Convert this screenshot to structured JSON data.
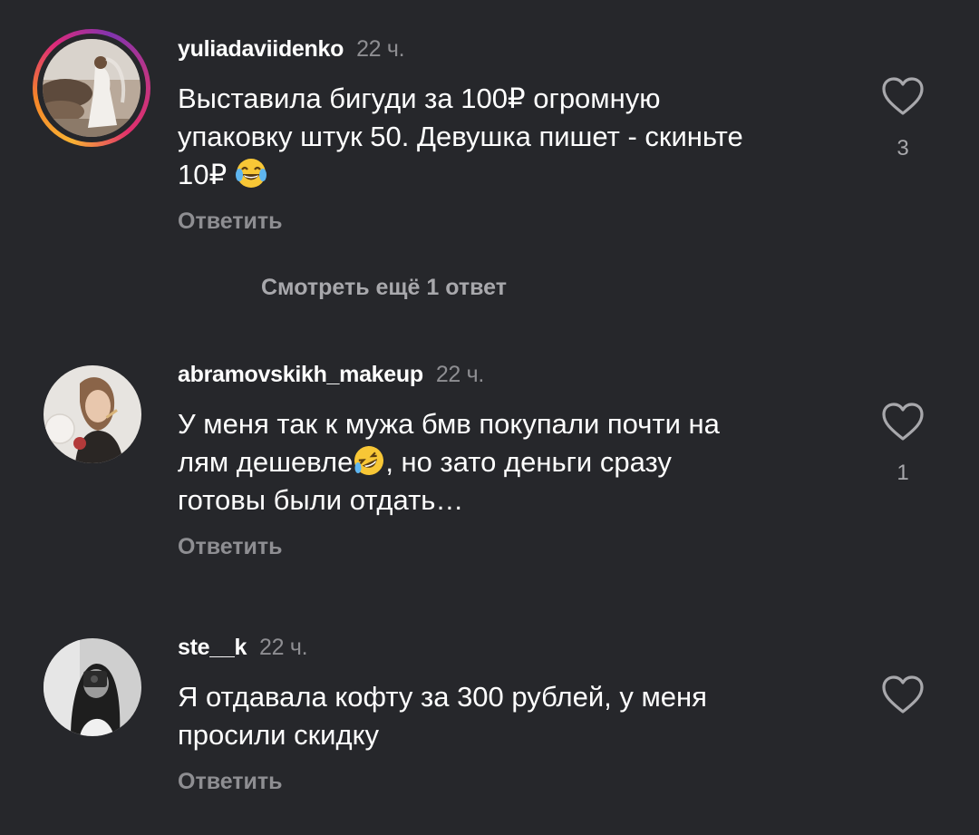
{
  "comments": [
    {
      "username": "yuliadaviidenko",
      "time": "22 ч.",
      "text_line1": "Выставила бигуди за 100₽ огромную",
      "text_line2": "упаковку штук 50. Девушка пишет - скиньте",
      "text_line3": "10₽",
      "emoji": "face-with-tears-of-joy",
      "reply_label": "Ответить",
      "likes": "3",
      "has_story_ring": true
    },
    {
      "username": "abramovskikh_makeup",
      "time": "22 ч.",
      "text_line1": "У меня так к мужа бмв покупали почти на",
      "text_line2a": "лям дешевле",
      "text_line2b": ", но зато деньги сразу",
      "text_line3": "готовы были отдать…",
      "emoji": "rolling-on-floor-laughing",
      "reply_label": "Ответить",
      "likes": "1",
      "has_story_ring": false
    },
    {
      "username": "ste__k",
      "time": "22 ч.",
      "text_line1": "Я отдавала кофту за 300 рублей, у меня",
      "text_line2": "просили скидку",
      "reply_label": "Ответить",
      "likes": "",
      "has_story_ring": false
    }
  ],
  "view_more_replies": "Смотреть ещё 1 ответ",
  "icons": {
    "like": "heart-outline-icon"
  },
  "colors": {
    "background": "#26272b",
    "secondary_text": "#8e8e92",
    "ring_start": "#f9b233",
    "ring_mid": "#dd2a7b",
    "ring_end": "#8134af"
  }
}
